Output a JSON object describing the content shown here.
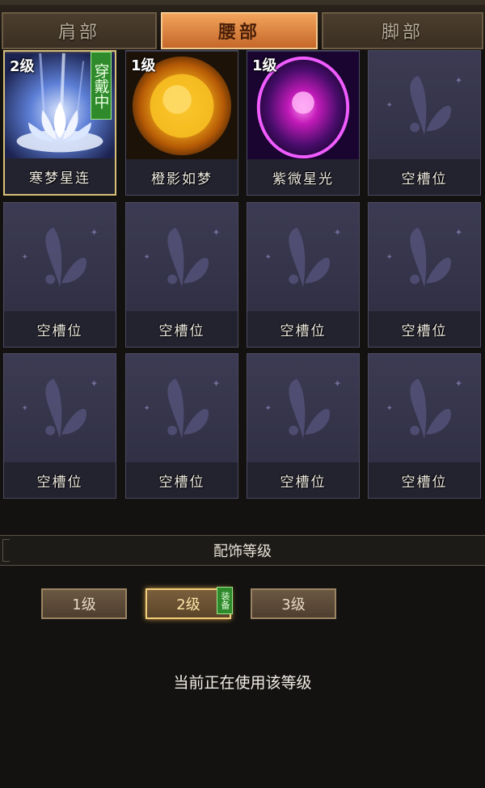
{
  "tabs": [
    {
      "label": "肩部",
      "active": false
    },
    {
      "label": "腰部",
      "active": true
    },
    {
      "label": "脚部",
      "active": false
    }
  ],
  "slots": [
    {
      "level": "2级",
      "name": "寒梦星连",
      "art": "lotus",
      "worn": "穿戴中"
    },
    {
      "level": "1级",
      "name": "橙影如梦",
      "art": "sun"
    },
    {
      "level": "1级",
      "name": "紫微星光",
      "art": "purple-orb"
    },
    {
      "name": "空槽位",
      "art": "empty"
    },
    {
      "name": "空槽位",
      "art": "empty"
    },
    {
      "name": "空槽位",
      "art": "empty"
    },
    {
      "name": "空槽位",
      "art": "empty"
    },
    {
      "name": "空槽位",
      "art": "empty"
    },
    {
      "name": "空槽位",
      "art": "empty"
    },
    {
      "name": "空槽位",
      "art": "empty"
    },
    {
      "name": "空槽位",
      "art": "empty"
    },
    {
      "name": "空槽位",
      "art": "empty"
    }
  ],
  "section": {
    "title": "配饰等级"
  },
  "level_buttons": [
    {
      "label": "1级",
      "active": false
    },
    {
      "label": "2级",
      "active": true
    },
    {
      "label": "3级",
      "active": false
    }
  ],
  "equip_tag": "装备",
  "status_text": "当前正在使用该等级",
  "colors": {
    "active_tab": "#f2a45b",
    "worn_badge": "#2f8a2c",
    "slot_bg": "#3c3b53"
  }
}
